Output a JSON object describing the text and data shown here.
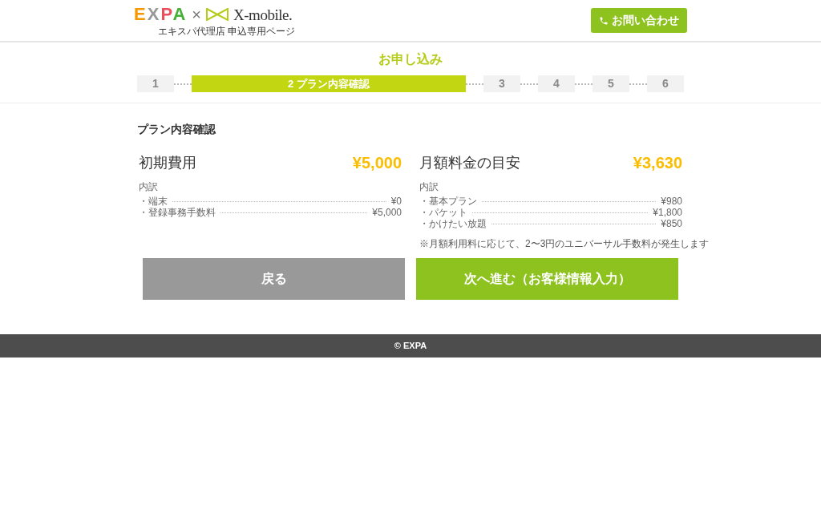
{
  "header": {
    "brand": "EXPA",
    "times": "×",
    "partner": "X-mobile.",
    "subtitle": "エキスパ代理店 申込専用ページ",
    "contact_button": "お問い合わせ"
  },
  "page_title": "お申し込み",
  "steps": [
    {
      "label": "1",
      "selected": false
    },
    {
      "label": "2 プラン内容確認",
      "selected": true
    },
    {
      "label": "3",
      "selected": false
    },
    {
      "label": "4",
      "selected": false
    },
    {
      "label": "5",
      "selected": false
    },
    {
      "label": "6",
      "selected": false
    }
  ],
  "section_title": "プラン内容確認",
  "costs": [
    {
      "title": "初期費用",
      "amount": "¥5,000",
      "breakdown_label": "内訳",
      "items": [
        {
          "name": "・端末",
          "price": "¥0"
        },
        {
          "name": "・登録事務手数料",
          "price": "¥5,000"
        }
      ]
    },
    {
      "title": "月額料金の目安",
      "amount": "¥3,630",
      "breakdown_label": "内訳",
      "items": [
        {
          "name": "・基本プラン",
          "price": "¥980"
        },
        {
          "name": "・パケット",
          "price": "¥1,800"
        },
        {
          "name": "・かけたい放題",
          "price": "¥850"
        }
      ],
      "note": "※月額利用料に応じて、2〜3円のユニバーサル手数料が発生します"
    }
  ],
  "buttons": [
    {
      "kind": "back",
      "label": "戻る"
    },
    {
      "kind": "next",
      "label": "次へ進む（お客様情報入力）"
    }
  ],
  "footer": "© EXPA"
}
